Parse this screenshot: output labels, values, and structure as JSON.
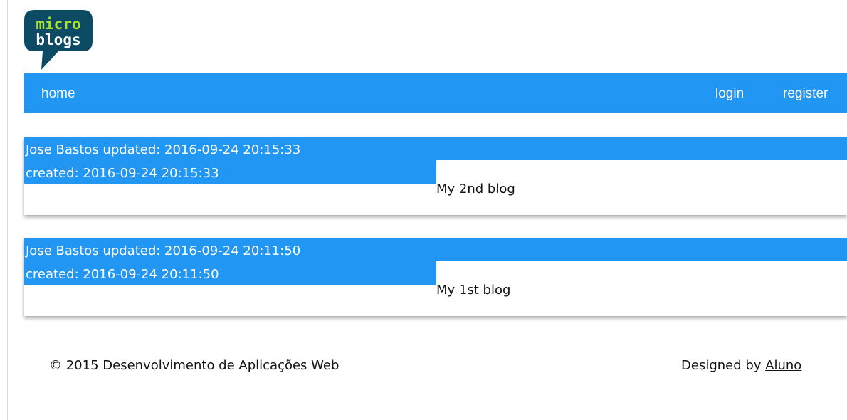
{
  "brand": {
    "logo_line1": "micro",
    "logo_line2": "blogs",
    "colors": {
      "bubble": "#0d4a63",
      "line1": "#a6e22e",
      "line2": "#ffffff"
    }
  },
  "nav": {
    "home": "home",
    "login": "login",
    "register": "register",
    "color": "#2196f3"
  },
  "posts": [
    {
      "line1": "Jose Bastos updated: 2016-09-24 20:15:33",
      "line2": "created: 2016-09-24 20:15:33",
      "body": "My 2nd blog"
    },
    {
      "line1": "Jose Bastos updated: 2016-09-24 20:11:50",
      "line2": "created: 2016-09-24 20:11:50",
      "body": "My 1st blog"
    }
  ],
  "footer": {
    "copyright": "© 2015 Desenvolvimento de Aplicações Web",
    "designed_by": "Designed by ",
    "author": "Aluno"
  }
}
